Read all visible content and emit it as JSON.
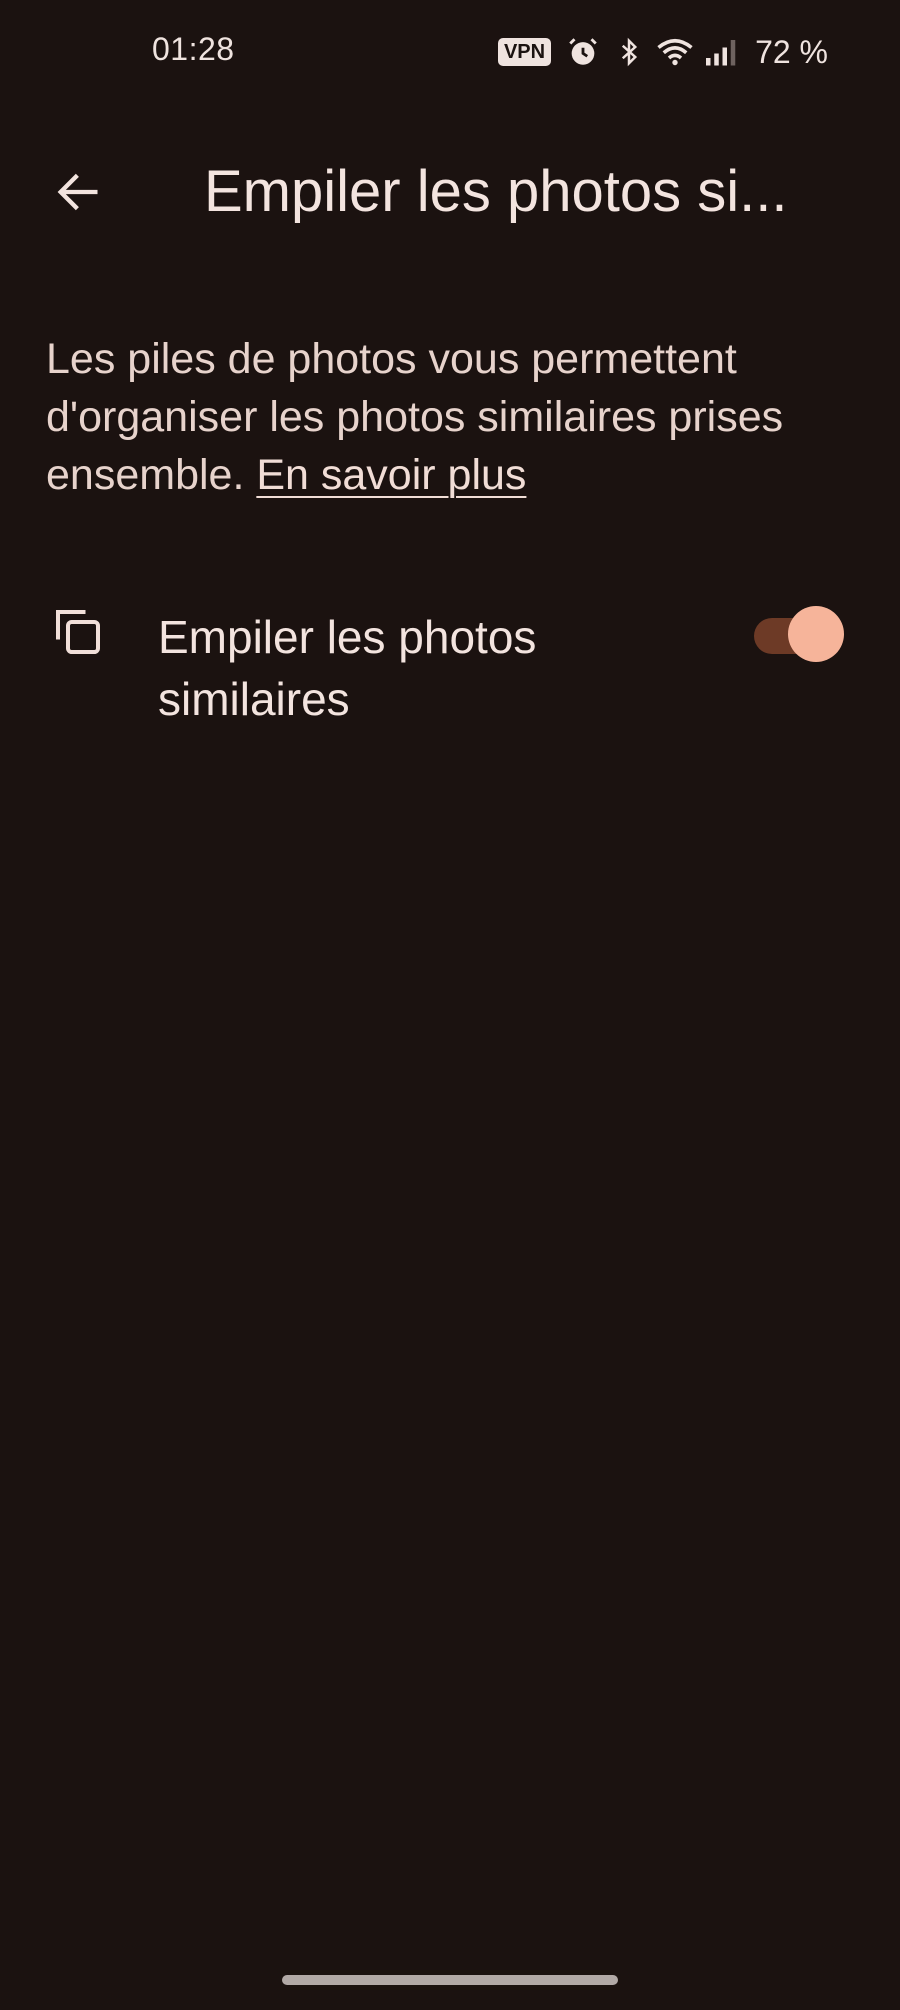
{
  "status_bar": {
    "time": "01:28",
    "vpn_label": "VPN",
    "battery": "72 %",
    "icons": [
      "vpn-icon",
      "alarm-icon",
      "bluetooth-icon",
      "wifi-icon",
      "signal-icon"
    ]
  },
  "app_bar": {
    "back_icon": "arrow-back-icon",
    "title": "Empiler les photos si..."
  },
  "description": {
    "text": "Les piles de photos vous permettent d'organiser les photos similaires prises ensemble. ",
    "link": "En savoir plus"
  },
  "setting": {
    "icon": "stack-photos-icon",
    "label": "Empiler les photos similaires",
    "enabled": true
  },
  "colors": {
    "background": "#1b1210",
    "toggle_track": "#6d3a26",
    "toggle_thumb": "#f6b49a",
    "text": "#f1dfd9"
  }
}
